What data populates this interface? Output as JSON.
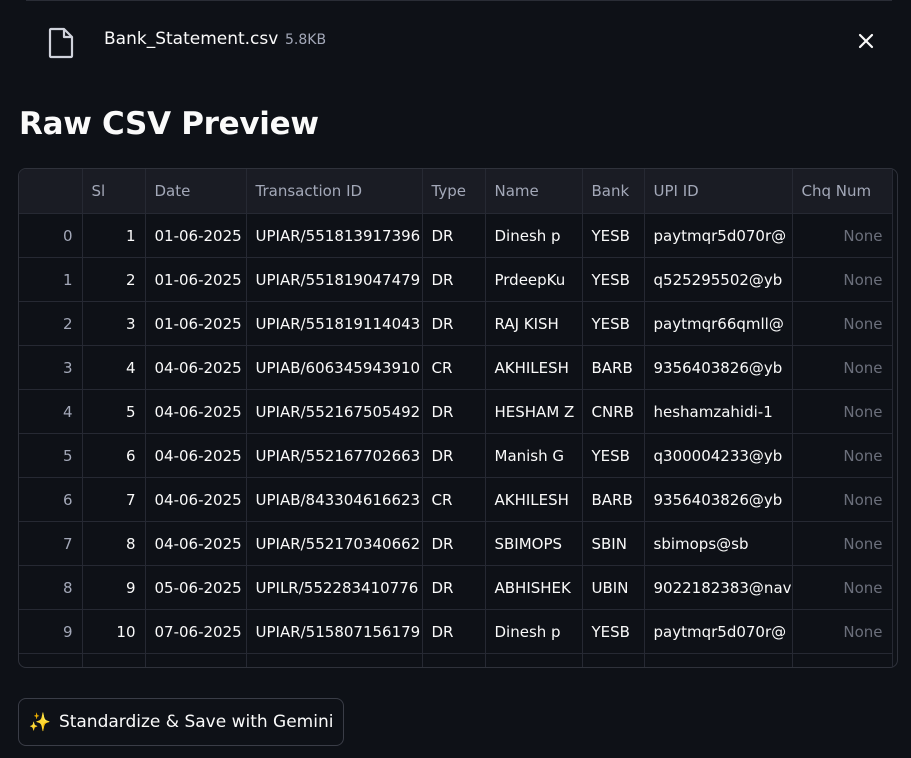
{
  "file": {
    "name": "Bank_Statement.csv",
    "size": "5.8KB"
  },
  "title": "Raw CSV Preview",
  "table": {
    "columns": [
      "",
      "Sl",
      "Date",
      "Transaction ID",
      "Type",
      "Name",
      "Bank",
      "UPI ID",
      "Chq Num"
    ],
    "rows": [
      [
        "0",
        "1",
        "01-06-2025",
        "UPIAR/551813917396",
        "DR",
        "Dinesh p",
        "YESB",
        "paytmqr5d070r@",
        "None"
      ],
      [
        "1",
        "2",
        "01-06-2025",
        "UPIAR/551819047479",
        "DR",
        "PrdeepKu",
        "YESB",
        "q525295502@yb",
        "None"
      ],
      [
        "2",
        "3",
        "01-06-2025",
        "UPIAR/551819114043",
        "DR",
        "RAJ KISH",
        "YESB",
        "paytmqr66qmll@",
        "None"
      ],
      [
        "3",
        "4",
        "04-06-2025",
        "UPIAB/606345943910",
        "CR",
        "AKHILESH",
        "BARB",
        "9356403826@yb",
        "None"
      ],
      [
        "4",
        "5",
        "04-06-2025",
        "UPIAR/552167505492",
        "DR",
        "HESHAM Z",
        "CNRB",
        "heshamzahidi-1",
        "None"
      ],
      [
        "5",
        "6",
        "04-06-2025",
        "UPIAR/552167702663",
        "DR",
        "Manish G",
        "YESB",
        "q300004233@yb",
        "None"
      ],
      [
        "6",
        "7",
        "04-06-2025",
        "UPIAB/843304616623",
        "CR",
        "AKHILESH",
        "BARB",
        "9356403826@yb",
        "None"
      ],
      [
        "7",
        "8",
        "04-06-2025",
        "UPIAR/552170340662",
        "DR",
        "SBIMOPS",
        "SBIN",
        "sbimops@sb",
        "None"
      ],
      [
        "8",
        "9",
        "05-06-2025",
        "UPILR/552283410776",
        "DR",
        "ABHISHEK",
        "UBIN",
        "9022182383@nav",
        "None"
      ],
      [
        "9",
        "10",
        "07-06-2025",
        "UPIAR/515807156179",
        "DR",
        "Dinesh p",
        "YESB",
        "paytmqr5d070r@",
        "None"
      ]
    ]
  },
  "action_button": {
    "label": "Standardize & Save with Gemini",
    "icon": "sparkles-icon"
  },
  "colors": {
    "background": "#0e1117",
    "header_bg": "#1a1c24",
    "muted_text": "#a3a8b8",
    "none_text": "#6b6f7b"
  }
}
